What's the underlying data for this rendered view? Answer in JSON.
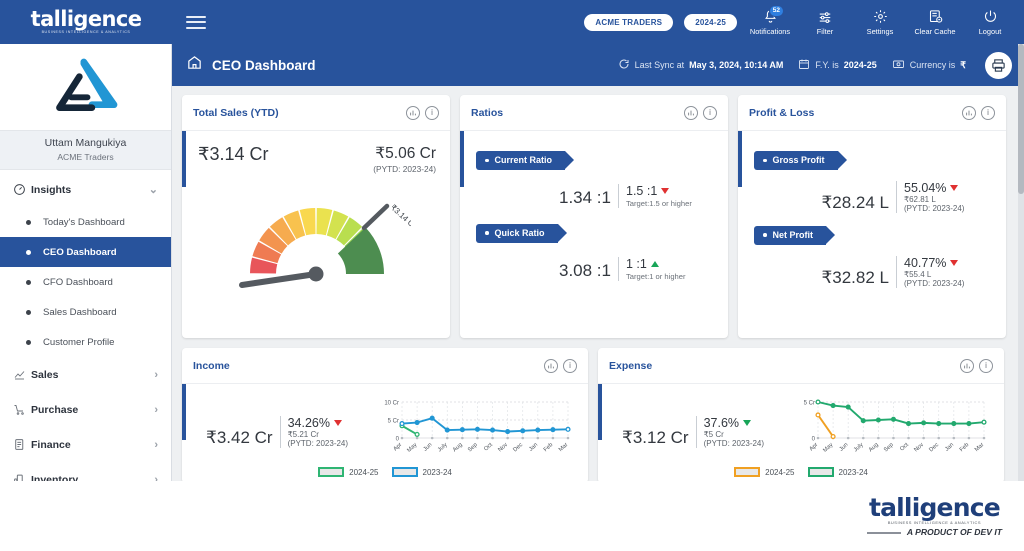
{
  "topbar": {
    "brand": "talligence",
    "brand_sub": "BUSINESS INTELLIGENCE & ANALYTICS",
    "menu_toggle": "hamburger-menu",
    "company_pill": "ACME TRADERS",
    "year_pill": "2024-25",
    "actions": [
      {
        "label": "Notifications",
        "icon": "bell-icon",
        "badge": "52"
      },
      {
        "label": "Filter",
        "icon": "filter-icon",
        "badge": ""
      },
      {
        "label": "Settings",
        "icon": "gear-icon",
        "badge": ""
      },
      {
        "label": "Clear Cache",
        "icon": "clear-cache-icon",
        "badge": ""
      },
      {
        "label": "Logout",
        "icon": "logout-icon",
        "badge": ""
      }
    ]
  },
  "sidebar": {
    "user_name": "Uttam Mangukiya",
    "user_org": "ACME Traders",
    "groups": [
      {
        "label": "Insights",
        "icon": "speedometer-icon",
        "expanded": true,
        "chevron": "chevron-down-icon"
      },
      {
        "label": "Sales",
        "icon": "sales-icon",
        "expanded": false,
        "chevron": "chevron-right-icon"
      },
      {
        "label": "Purchase",
        "icon": "purchase-icon",
        "expanded": false,
        "chevron": "chevron-right-icon"
      },
      {
        "label": "Finance",
        "icon": "finance-icon",
        "expanded": false,
        "chevron": "chevron-right-icon"
      },
      {
        "label": "Inventory",
        "icon": "inventory-icon",
        "expanded": false,
        "chevron": "chevron-right-icon"
      }
    ],
    "insight_items": [
      {
        "label": "Today's Dashboard",
        "active": false
      },
      {
        "label": "CEO Dashboard",
        "active": true
      },
      {
        "label": "CFO Dashboard",
        "active": false
      },
      {
        "label": "Sales Dashboard",
        "active": false
      },
      {
        "label": "Customer Profile",
        "active": false
      }
    ]
  },
  "page_header": {
    "home_icon": "home-icon",
    "title": "CEO Dashboard",
    "sync_icon": "refresh-icon",
    "sync_prefix": "Last Sync at",
    "sync_value": "May 3, 2024, 10:14 AM",
    "fy_icon": "calendar-icon",
    "fy_prefix": "F.Y. is",
    "fy_value": "2024-25",
    "currency_icon": "money-icon",
    "currency_prefix": "Currency is",
    "currency_value": "₹",
    "print_icon": "print-report-icon"
  },
  "cards": {
    "total_sales": {
      "title": "Total Sales (YTD)",
      "value": "₹3.14 Cr",
      "prior_value": "₹5.06 Cr",
      "prior_label": "(PYTD: 2023-24)",
      "gauge_label": "₹3.14 Cr"
    },
    "ratios": {
      "title": "Ratios",
      "items": [
        {
          "tag": "Current Ratio",
          "value": "1.34 :1",
          "compare": "1.5 :1",
          "trend": "down",
          "target": "Target:1.5 or higher"
        },
        {
          "tag": "Quick Ratio",
          "value": "3.08 :1",
          "compare": "1 :1",
          "trend": "up",
          "target": "Target:1 or higher"
        }
      ]
    },
    "profit_loss": {
      "title": "Profit & Loss",
      "items": [
        {
          "tag": "Gross Profit",
          "value": "₹28.24 L",
          "percent": "55.04%",
          "trend": "down",
          "prior_value": "₹62.81 L",
          "prior_label": "(PYTD: 2023-24)"
        },
        {
          "tag": "Net Profit",
          "value": "₹32.82 L",
          "percent": "40.77%",
          "trend": "down",
          "prior_value": "₹55.4 L",
          "prior_label": "(PYTD: 2023-24)"
        }
      ]
    },
    "income": {
      "title": "Income",
      "value": "₹3.42 Cr",
      "percent": "34.26%",
      "trend": "down",
      "prior_value": "₹5.21 Cr",
      "prior_label": "(PYTD: 2023-24)"
    },
    "expense": {
      "title": "Expense",
      "value": "₹3.12 Cr",
      "percent": "37.6%",
      "trend": "down-good",
      "prior_value": "₹5 Cr",
      "prior_label": "(PYTD: 2023-24)"
    },
    "tool_icons": {
      "drill": "drill-chart-icon",
      "info": "info-icon"
    }
  },
  "chart_data": [
    {
      "id": "total_sales_gauge",
      "type": "gauge",
      "title": "Total Sales (YTD)",
      "value": 3.14,
      "value_label": "₹3.14 Cr",
      "min": 0,
      "max": 5.06,
      "needle_angle_deg": 188,
      "bands": [
        "#e8555a",
        "#ef7b52",
        "#f3944f",
        "#f6ab4f",
        "#f8c24e",
        "#f9d84f",
        "#eae24f",
        "#d3e24f",
        "#b9de4f",
        "#9ad84f",
        "#6cce5a",
        "#4aa85c"
      ],
      "dark_band_color": "#4d8d50"
    },
    {
      "id": "income_trend",
      "type": "line",
      "title": "Income",
      "categories": [
        "Apr",
        "May",
        "Jun",
        "July",
        "Aug",
        "Sep",
        "Oct",
        "Nov",
        "Dec",
        "Jan",
        "Feb",
        "Mar"
      ],
      "ylabel": "",
      "ylim": [
        0,
        10
      ],
      "ytick_labels": [
        "0",
        "5 Cr",
        "10 Cr"
      ],
      "grid": true,
      "legend_position": "bottom",
      "series": [
        {
          "name": "2024-25",
          "color": "#2fb573",
          "values": [
            3.4,
            1.0,
            null,
            null,
            null,
            null,
            null,
            null,
            null,
            null,
            null,
            null
          ]
        },
        {
          "name": "2023-24",
          "color": "#2196d4",
          "values": [
            4.0,
            4.3,
            5.5,
            2.2,
            2.3,
            2.4,
            2.2,
            1.8,
            2.0,
            2.2,
            2.3,
            2.4
          ]
        }
      ]
    },
    {
      "id": "expense_trend",
      "type": "line",
      "title": "Expense",
      "categories": [
        "Apr",
        "May",
        "Jun",
        "July",
        "Aug",
        "Sep",
        "Oct",
        "Nov",
        "Dec",
        "Jan",
        "Feb",
        "Mar"
      ],
      "ylabel": "",
      "ylim": [
        0,
        5
      ],
      "ytick_labels": [
        "0",
        "5 Cr"
      ],
      "grid": true,
      "legend_position": "bottom",
      "series": [
        {
          "name": "2024-25",
          "color": "#f0a022",
          "values": [
            3.2,
            0.2,
            null,
            null,
            null,
            null,
            null,
            null,
            null,
            null,
            null,
            null
          ]
        },
        {
          "name": "2023-24",
          "color": "#22a96e",
          "values": [
            5.0,
            4.5,
            4.3,
            2.4,
            2.5,
            2.6,
            2.0,
            2.1,
            2.0,
            2.0,
            2.0,
            2.2
          ]
        }
      ]
    }
  ],
  "footer": {
    "brand": "talligence",
    "sub": "BUSINESS INTELLIGENCE & ANALYTICS",
    "tagline": "A PRODUCT OF DEV IT"
  },
  "colors": {
    "primary": "#28539c",
    "up": "#18a558",
    "down": "#e03131",
    "background": "#eef0f2"
  }
}
